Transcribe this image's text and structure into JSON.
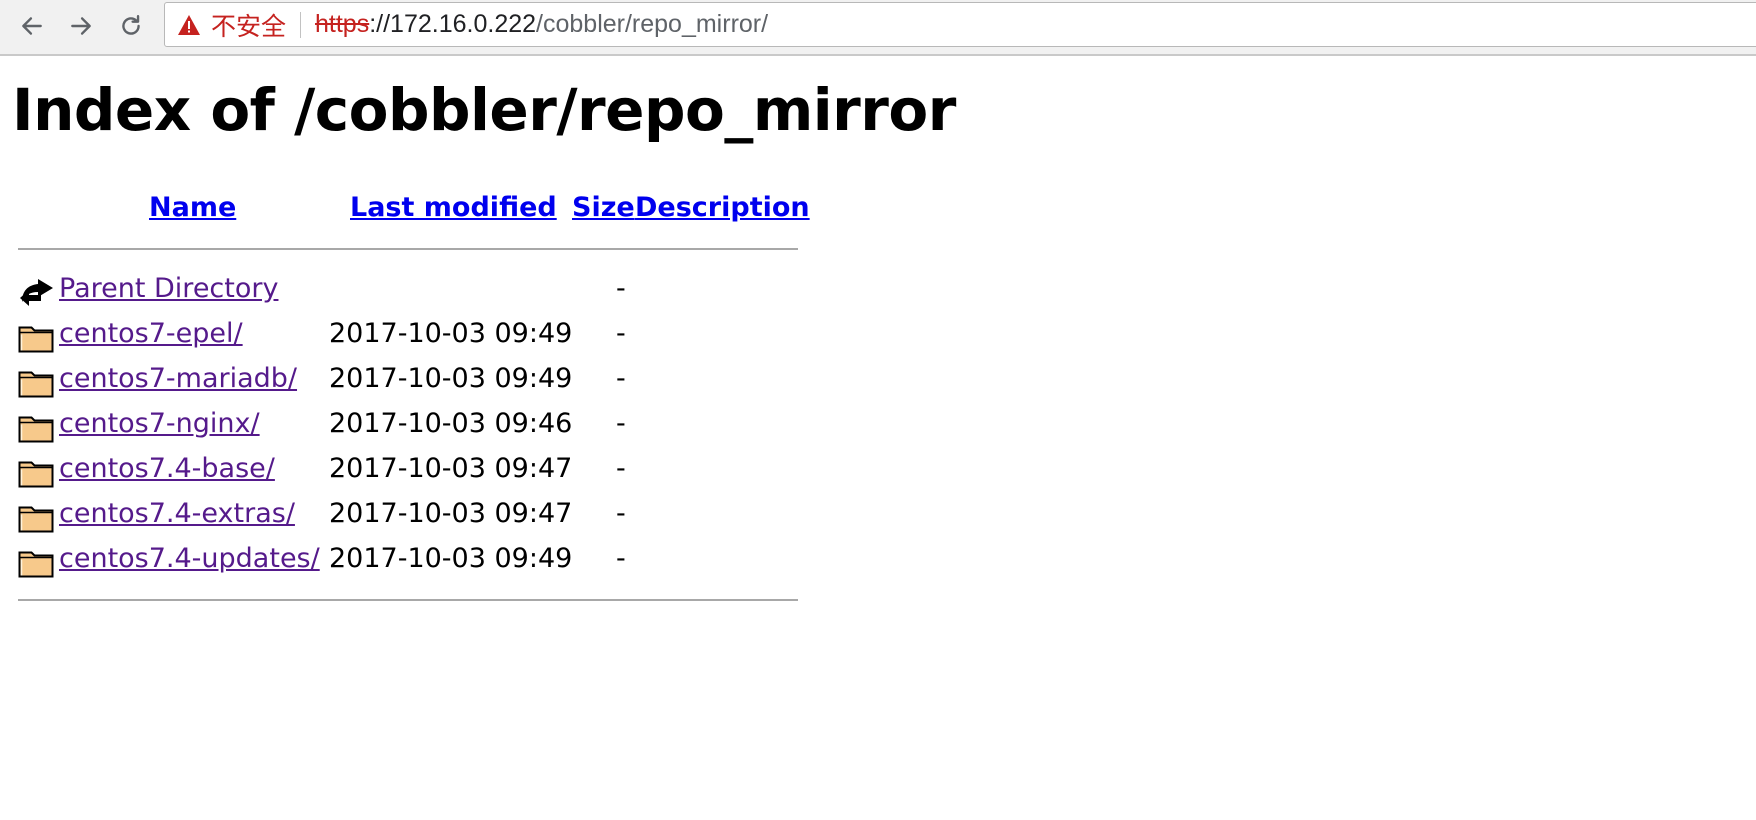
{
  "browser": {
    "security_label": "不安全",
    "url_scheme": "https",
    "url_host": "://172.16.0.222",
    "url_path": "/cobbler/repo_mirror/"
  },
  "page": {
    "title": "Index of /cobbler/repo_mirror"
  },
  "columns": {
    "name": "Name",
    "last_modified": "Last modified",
    "size": "Size",
    "description": "Description"
  },
  "rows": [
    {
      "icon": "back-icon",
      "name": "Parent Directory",
      "modified": "",
      "size": "-"
    },
    {
      "icon": "folder-icon",
      "name": "centos7-epel/",
      "modified": "2017-10-03 09:49",
      "size": "-"
    },
    {
      "icon": "folder-icon",
      "name": "centos7-mariadb/",
      "modified": "2017-10-03 09:49",
      "size": "-"
    },
    {
      "icon": "folder-icon",
      "name": "centos7-nginx/",
      "modified": "2017-10-03 09:46",
      "size": "-"
    },
    {
      "icon": "folder-icon",
      "name": "centos7.4-base/",
      "modified": "2017-10-03 09:47",
      "size": "-"
    },
    {
      "icon": "folder-icon",
      "name": "centos7.4-extras/",
      "modified": "2017-10-03 09:47",
      "size": "-"
    },
    {
      "icon": "folder-icon",
      "name": "centos7.4-updates/",
      "modified": "2017-10-03 09:49",
      "size": "-"
    }
  ],
  "colors": {
    "link": "#0000ee",
    "visited": "#551a8b",
    "warning": "#c5221f",
    "folder": "#f7c98b"
  }
}
